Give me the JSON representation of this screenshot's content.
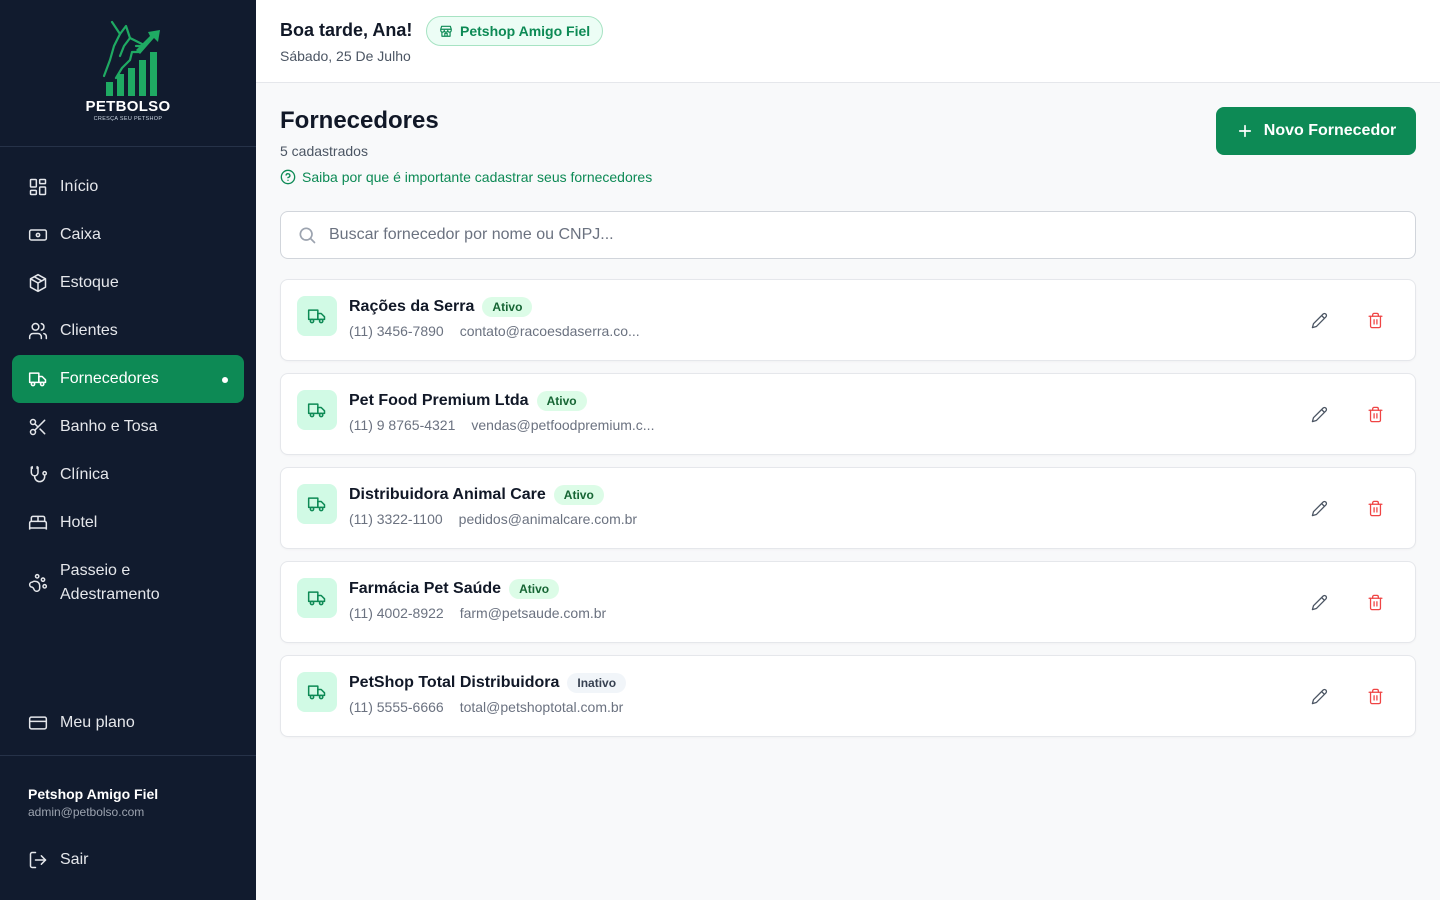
{
  "brand": {
    "name": "PETBOLSO",
    "tagline": "CRESÇA SEU PETSHOP",
    "accent": "#0d8a55",
    "sidebar_bg": "#111b2e"
  },
  "sidebar": {
    "items": [
      {
        "label": "Início",
        "icon": "grid-icon"
      },
      {
        "label": "Caixa",
        "icon": "cash-icon"
      },
      {
        "label": "Estoque",
        "icon": "box-icon"
      },
      {
        "label": "Clientes",
        "icon": "users-icon"
      },
      {
        "label": "Fornecedores",
        "icon": "truck-icon",
        "active": true
      },
      {
        "label": "Banho e Tosa",
        "icon": "scissors-icon"
      },
      {
        "label": "Clínica",
        "icon": "stethoscope-icon"
      },
      {
        "label": "Hotel",
        "icon": "bed-icon"
      },
      {
        "label": "Passeio e Adestramento",
        "icon": "paw-icon"
      }
    ],
    "plan_label": "Meu plano",
    "account_name": "Petshop Amigo Fiel",
    "account_email": "admin@petbolso.com",
    "logout_label": "Sair"
  },
  "header": {
    "greeting": "Boa tarde, Ana!",
    "store_badge": "Petshop Amigo Fiel",
    "date": "Sábado, 25 De Julho"
  },
  "main": {
    "title": "Fornecedores",
    "count": "5 cadastrados",
    "help_link": "Saiba por que é importante cadastrar seus fornecedores",
    "new_button": "Novo Fornecedor",
    "search_placeholder": "Buscar fornecedor por nome ou CNPJ..."
  },
  "suppliers": [
    {
      "name": "Rações da Serra",
      "status": "Ativo",
      "phone": "(11) 3456-7890",
      "email": "contato@racoesdaserra.co..."
    },
    {
      "name": "Pet Food Premium Ltda",
      "status": "Ativo",
      "phone": "(11) 9 8765-4321",
      "email": "vendas@petfoodpremium.c..."
    },
    {
      "name": "Distribuidora Animal Care",
      "status": "Ativo",
      "phone": "(11) 3322-1100",
      "email": "pedidos@animalcare.com.br"
    },
    {
      "name": "Farmácia Pet Saúde",
      "status": "Ativo",
      "phone": "(11) 4002-8922",
      "email": "farm@petsaude.com.br"
    },
    {
      "name": "PetShop Total Distribuidora",
      "status": "Inativo",
      "phone": "(11) 5555-6666",
      "email": "total@petshoptotal.com.br"
    }
  ]
}
